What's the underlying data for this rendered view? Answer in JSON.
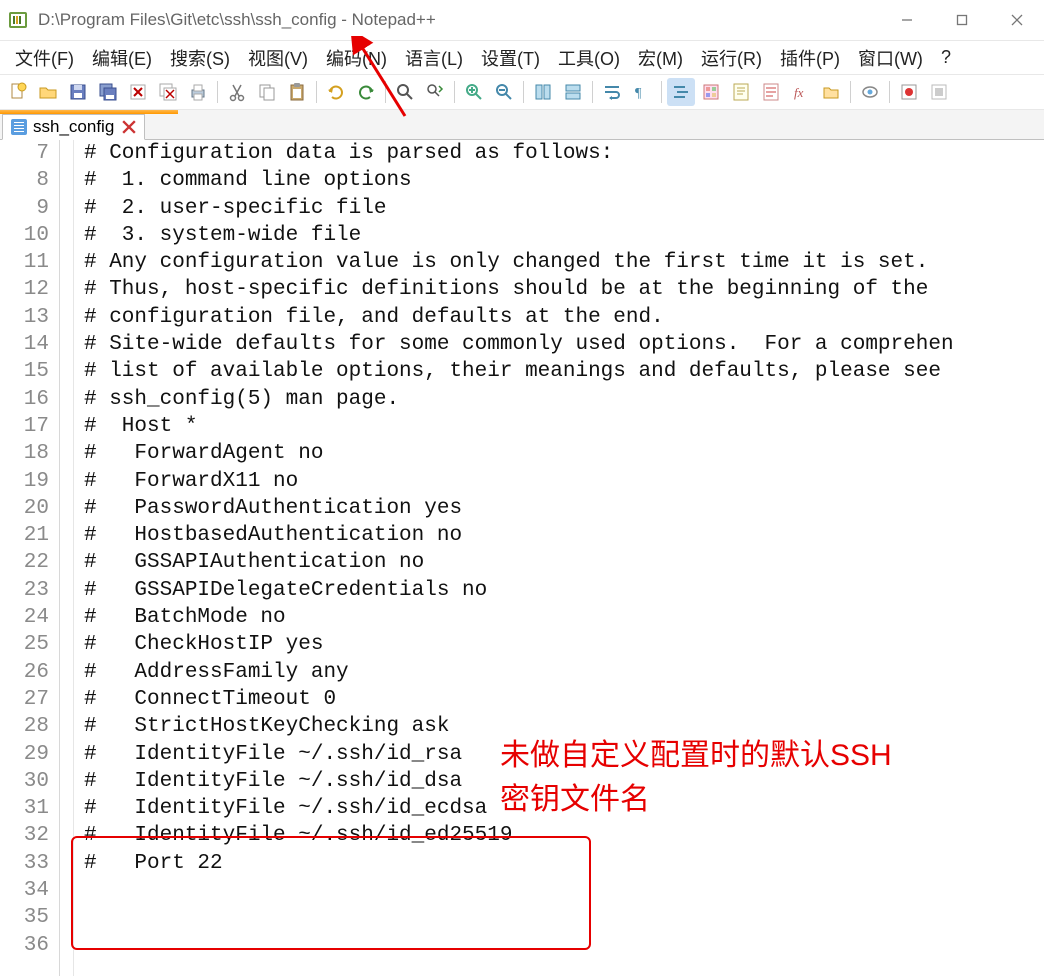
{
  "window": {
    "title": "D:\\Program Files\\Git\\etc\\ssh\\ssh_config - Notepad++"
  },
  "menu": {
    "items": [
      "文件(F)",
      "编辑(E)",
      "搜索(S)",
      "视图(V)",
      "编码(N)",
      "语言(L)",
      "设置(T)",
      "工具(O)",
      "宏(M)",
      "运行(R)",
      "插件(P)",
      "窗口(W)",
      "?"
    ]
  },
  "tab": {
    "name": "ssh_config"
  },
  "lines": [
    {
      "n": 7,
      "t": ""
    },
    {
      "n": 8,
      "t": "# Configuration data is parsed as follows:"
    },
    {
      "n": 9,
      "t": "#  1. command line options"
    },
    {
      "n": 10,
      "t": "#  2. user-specific file"
    },
    {
      "n": 11,
      "t": "#  3. system-wide file"
    },
    {
      "n": 12,
      "t": "# Any configuration value is only changed the first time it is set."
    },
    {
      "n": 13,
      "t": "# Thus, host-specific definitions should be at the beginning of the"
    },
    {
      "n": 14,
      "t": "# configuration file, and defaults at the end."
    },
    {
      "n": 15,
      "t": ""
    },
    {
      "n": 16,
      "t": "# Site-wide defaults for some commonly used options.  For a comprehen"
    },
    {
      "n": 17,
      "t": "# list of available options, their meanings and defaults, please see"
    },
    {
      "n": 18,
      "t": "# ssh_config(5) man page."
    },
    {
      "n": 19,
      "t": ""
    },
    {
      "n": 20,
      "t": "#  Host *"
    },
    {
      "n": 21,
      "t": "#   ForwardAgent no"
    },
    {
      "n": 22,
      "t": "#   ForwardX11 no"
    },
    {
      "n": 23,
      "t": "#   PasswordAuthentication yes"
    },
    {
      "n": 24,
      "t": "#   HostbasedAuthentication no"
    },
    {
      "n": 25,
      "t": "#   GSSAPIAuthentication no"
    },
    {
      "n": 26,
      "t": "#   GSSAPIDelegateCredentials no"
    },
    {
      "n": 27,
      "t": "#   BatchMode no"
    },
    {
      "n": 28,
      "t": "#   CheckHostIP yes"
    },
    {
      "n": 29,
      "t": "#   AddressFamily any"
    },
    {
      "n": 30,
      "t": "#   ConnectTimeout 0"
    },
    {
      "n": 31,
      "t": "#   StrictHostKeyChecking ask"
    },
    {
      "n": 32,
      "t": "#   IdentityFile ~/.ssh/id_rsa"
    },
    {
      "n": 33,
      "t": "#   IdentityFile ~/.ssh/id_dsa"
    },
    {
      "n": 34,
      "t": "#   IdentityFile ~/.ssh/id_ecdsa"
    },
    {
      "n": 35,
      "t": "#   IdentityFile ~/.ssh/id_ed25519"
    },
    {
      "n": 36,
      "t": "#   Port 22"
    }
  ],
  "annotation": {
    "text_line1": "未做自定义配置时的默认SSH",
    "text_line2": "密钥文件名"
  }
}
